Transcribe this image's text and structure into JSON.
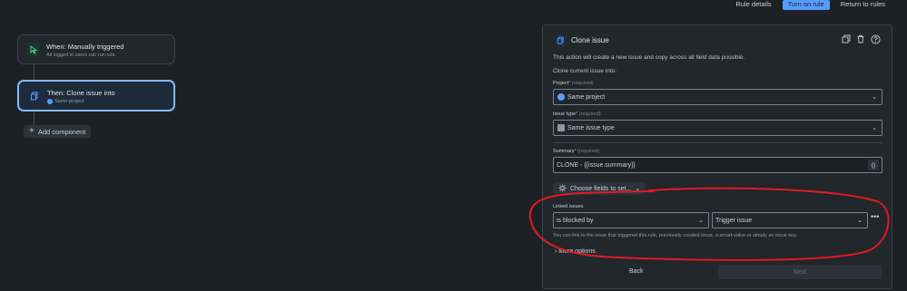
{
  "topbar": {
    "rule_details": "Rule details",
    "turn_on_rule": "Turn on rule",
    "return_to_rules": "Return to rules"
  },
  "rule": {
    "trigger": {
      "title": "When: Manually triggered",
      "subtitle": "All logged in users can run rule."
    },
    "action": {
      "title": "Then: Clone issue into",
      "subtitle": "Same project"
    },
    "add_component": "Add component"
  },
  "panel": {
    "title": "Clone issue",
    "description": "This action will create a new issue and copy across all field data possible.",
    "clone_into": "Clone current issue into:",
    "project": {
      "label": "Project",
      "required": "(required)",
      "value": "Same project"
    },
    "issue_type": {
      "label": "Issue type",
      "required": "(required)",
      "value": "Same issue type"
    },
    "summary": {
      "label": "Summary",
      "required": "(required)",
      "value": "CLONE - {{issue.summary}}",
      "smart_value_button": "{}"
    },
    "choose_fields": "Choose fields to set...",
    "linked_issues": {
      "label": "Linked issues",
      "link_type": "is blocked by",
      "target": "Trigger issue",
      "help": "You can link to the issue that triggered this rule, previously created issue, a smart-value or simply an issue key."
    },
    "more_options": "More options",
    "back": "Back",
    "next": "Next"
  },
  "colors": {
    "background": "#1d2125",
    "primary_button": "#579dff",
    "selected_node_border": "#85b8ff",
    "annotation": "#e01b24"
  },
  "icons": [
    "cursor-icon",
    "clone-icon",
    "plus-icon",
    "duplicate-icon",
    "trash-icon",
    "help-icon",
    "gear-icon",
    "chevron-down-icon",
    "more-icon"
  ]
}
